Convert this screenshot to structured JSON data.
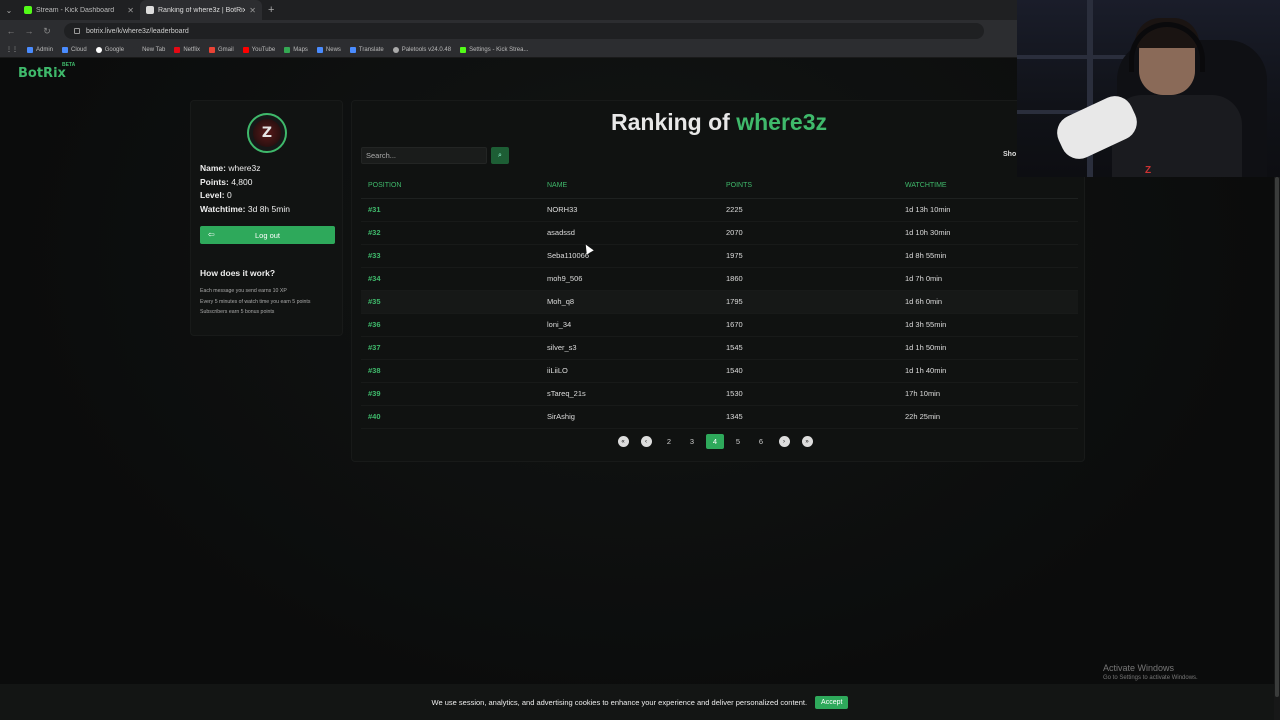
{
  "browser": {
    "tabs": [
      {
        "label": "Stream - Kick Dashboard",
        "active": false,
        "icon": "kick-icon",
        "color": "#53fc18"
      },
      {
        "label": "Ranking of where3z | BotRix -...",
        "active": true,
        "icon": "botrix-icon",
        "color": "#dddddd"
      }
    ],
    "url": "botrix.live/k/where3z/leaderboard",
    "bookmarks": [
      {
        "label": "Admin",
        "color": "#4a8cff"
      },
      {
        "label": "Cloud",
        "color": "#4a8cff"
      },
      {
        "label": "Google",
        "color": "#ffffff"
      },
      {
        "label": "New Tab",
        "color": "#2c2d30"
      },
      {
        "label": "Netflix",
        "color": "#e50914"
      },
      {
        "label": "Gmail",
        "color": "#ea4335"
      },
      {
        "label": "YouTube",
        "color": "#ff0000"
      },
      {
        "label": "Maps",
        "color": "#34a853"
      },
      {
        "label": "News",
        "color": "#4a8cff"
      },
      {
        "label": "Translate",
        "color": "#4a8cff"
      },
      {
        "label": "Paletools v24.0.48",
        "color": "#aaaaaa"
      },
      {
        "label": "Settings - Kick Strea...",
        "color": "#53fc18"
      }
    ]
  },
  "site": {
    "logo": "BotRix",
    "logo_badge": "BETA",
    "accent": "#3fb96b"
  },
  "profile": {
    "avatar_letter": "Z",
    "name_label": "Name:",
    "name": "where3z",
    "points_label": "Points:",
    "points": "4,800",
    "level_label": "Level:",
    "level": "0",
    "watchtime_label": "Watchtime:",
    "watchtime": "3d 8h 5min",
    "logout": "Log out",
    "how_title": "How does it work?",
    "how_lines": [
      "Each message you send earns 10 XP",
      "Every 5 minutes of watch time you earn 5 points",
      "Subscribers earn 5 bonus points"
    ]
  },
  "ranking": {
    "title_prefix": "Ranking of",
    "title_user": "where3z",
    "search_placeholder": "Search...",
    "show_label": "Sho",
    "headers": [
      "POSITION",
      "NAME",
      "POINTS",
      "WATCHTIME"
    ],
    "rows": [
      {
        "position": "#31",
        "name": "NORH33",
        "points": "2225",
        "watchtime": "1d 13h 10min"
      },
      {
        "position": "#32",
        "name": "asadssd",
        "points": "2070",
        "watchtime": "1d 10h 30min"
      },
      {
        "position": "#33",
        "name": "Seba110066",
        "points": "1975",
        "watchtime": "1d 8h 55min"
      },
      {
        "position": "#34",
        "name": "moh9_506",
        "points": "1860",
        "watchtime": "1d 7h 0min"
      },
      {
        "position": "#35",
        "name": "Moh_q8",
        "points": "1795",
        "watchtime": "1d 6h 0min"
      },
      {
        "position": "#36",
        "name": "loni_34",
        "points": "1670",
        "watchtime": "1d 3h 55min"
      },
      {
        "position": "#37",
        "name": "silver_s3",
        "points": "1545",
        "watchtime": "1d 1h 50min"
      },
      {
        "position": "#38",
        "name": "iiLiiLO",
        "points": "1540",
        "watchtime": "1d 1h 40min"
      },
      {
        "position": "#39",
        "name": "sTareq_21s",
        "points": "1530",
        "watchtime": "17h 10min"
      },
      {
        "position": "#40",
        "name": "SirAshig",
        "points": "1345",
        "watchtime": "22h 25min"
      }
    ],
    "pagination": {
      "pages": [
        "2",
        "3",
        "4",
        "5",
        "6"
      ],
      "current": "4"
    }
  },
  "cookie": {
    "text": "We use session, analytics, and advertising cookies to enhance your experience and deliver personalized content.",
    "accept": "Accept"
  },
  "windows_watermark": {
    "line1": "Activate Windows",
    "line2": "Go to Settings to activate Windows."
  }
}
